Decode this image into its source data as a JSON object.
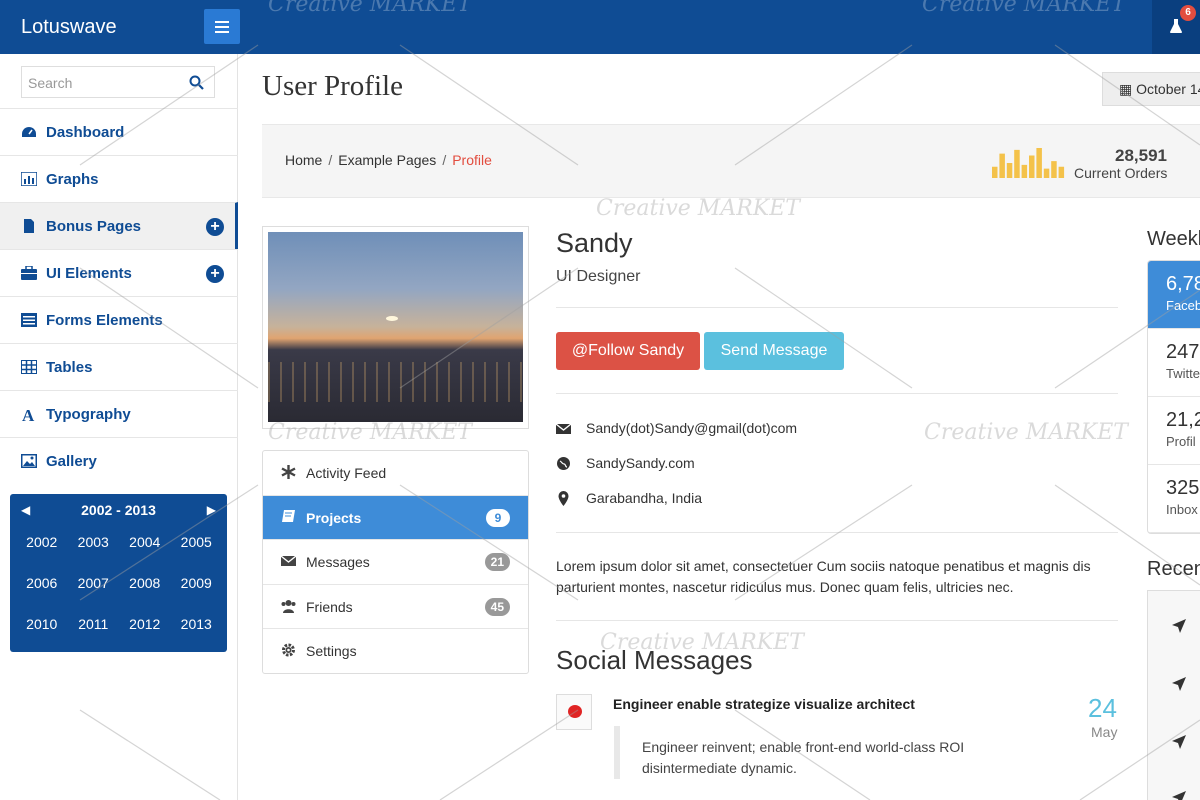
{
  "app": {
    "brand": "Lotuswave",
    "notification_count": "6",
    "watermark": "Creative MARKET"
  },
  "sidebar": {
    "search_placeholder": "Search",
    "items": [
      {
        "label": "Dashboard",
        "icon": "dashboard-icon"
      },
      {
        "label": "Graphs",
        "icon": "bar-chart-icon"
      },
      {
        "label": "Bonus Pages",
        "icon": "file-icon",
        "expandable": true,
        "active": true
      },
      {
        "label": "UI Elements",
        "icon": "briefcase-icon",
        "expandable": true
      },
      {
        "label": "Forms Elements",
        "icon": "list-icon"
      },
      {
        "label": "Tables",
        "icon": "table-icon"
      },
      {
        "label": "Typography",
        "icon": "font-icon"
      },
      {
        "label": "Gallery",
        "icon": "image-icon"
      }
    ],
    "calendar": {
      "range": "2002 - 2013",
      "years": [
        "2002",
        "2003",
        "2004",
        "2005",
        "2006",
        "2007",
        "2008",
        "2009",
        "2010",
        "2011",
        "2012",
        "2013"
      ]
    }
  },
  "page": {
    "title": "User Profile",
    "date_button": "October 14"
  },
  "breadcrumb": {
    "items": [
      "Home",
      "Example Pages"
    ],
    "current": "Profile"
  },
  "stats": {
    "value": "28,591",
    "label": "Current Orders",
    "spark": [
      12,
      26,
      16,
      30,
      14,
      24,
      32,
      10,
      18,
      12
    ],
    "color": "#f4c24a"
  },
  "profile_menu": [
    {
      "label": "Activity Feed",
      "icon": "asterisk-icon",
      "badge": ""
    },
    {
      "label": "Projects",
      "icon": "book-icon",
      "badge": "9",
      "active": true
    },
    {
      "label": "Messages",
      "icon": "envelope-icon",
      "badge": "21"
    },
    {
      "label": "Friends",
      "icon": "users-icon",
      "badge": "45"
    },
    {
      "label": "Settings",
      "icon": "gear-icon",
      "badge": ""
    }
  ],
  "profile": {
    "name": "Sandy",
    "role": "UI Designer",
    "follow_label": "@Follow Sandy",
    "message_label": "Send Message",
    "email": "Sandy(dot)Sandy@gmail(dot)com",
    "website": "SandySandy.com",
    "location": "Garabandha, India",
    "bio": "Lorem ipsum dolor sit amet, consectetuer Cum sociis natoque penatibus et magnis dis parturient montes, nascetur ridiculus mus. Donec quam felis, ultricies nec."
  },
  "social": {
    "title": "Social Messages",
    "message": {
      "title": "Engineer enable strategize visualize architect",
      "body": "Engineer reinvent; enable front-end world-class ROI disintermediate dynamic.",
      "day": "24",
      "month": "May"
    }
  },
  "weekly": {
    "title": "Weekly",
    "items": [
      {
        "value": "6,78",
        "label": "Faceb",
        "active": true
      },
      {
        "value": "247",
        "label": "Twitte"
      },
      {
        "value": "21,2",
        "label": "Profil"
      },
      {
        "value": "325",
        "label": "Inbox"
      }
    ]
  },
  "recent": {
    "title": "Recen"
  }
}
